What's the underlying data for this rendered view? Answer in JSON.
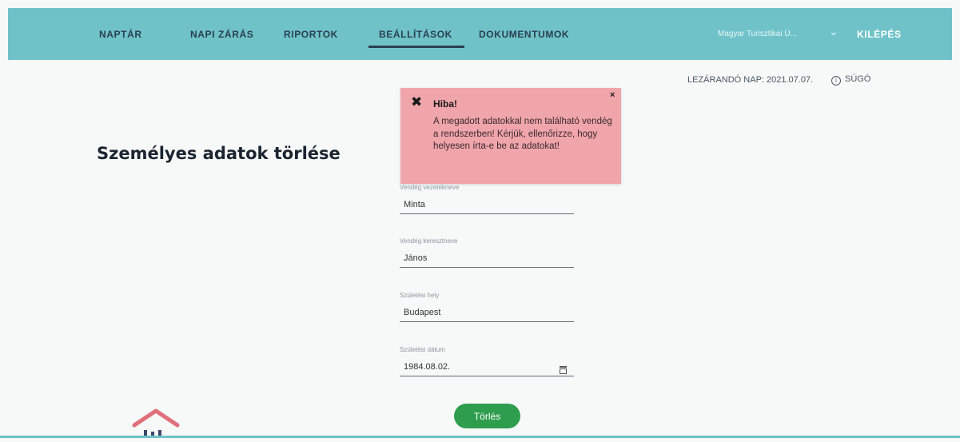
{
  "nav": {
    "items": [
      {
        "label": "NAPTÁR"
      },
      {
        "label": "NAPI ZÁRÁS"
      },
      {
        "label": "RIPORTOK"
      },
      {
        "label": "BEÁLLÍTÁSOK",
        "active": true
      },
      {
        "label": "DOKUMENTUMOK"
      }
    ],
    "company": "Magyar Turisztikai Ü...",
    "logout": "KILÉPÉS"
  },
  "info": {
    "closing_day": "LEZÁRANDÓ NAP: 2021.07.07.",
    "help": "SÚGÓ"
  },
  "page": {
    "title": "Személyes adatok törlése"
  },
  "form": {
    "last_name": {
      "label": "Vendég vezetékneve",
      "value": "Minta"
    },
    "first_name": {
      "label": "Vendég keresztneve",
      "value": "János"
    },
    "birth_place": {
      "label": "Születési hely",
      "value": "Budapest"
    },
    "birth_date": {
      "label": "Születési dátum",
      "value": "1984.08.02."
    },
    "delete_button": "Törlés"
  },
  "alert": {
    "icon": "close-x-icon",
    "title": "Hiba!",
    "message": "A megadott adatokkal nem található vendég a rendszerben! Kérjük, ellenőrizze, hogy helyesen írta-e be az adatokat!",
    "close": "×"
  },
  "colors": {
    "header": "#6fc3c8",
    "nav_text": "#2b3f4e",
    "alert_bg": "#f0a5ab",
    "button": "#2e9d4e",
    "logo_roof": "#e0707a"
  }
}
